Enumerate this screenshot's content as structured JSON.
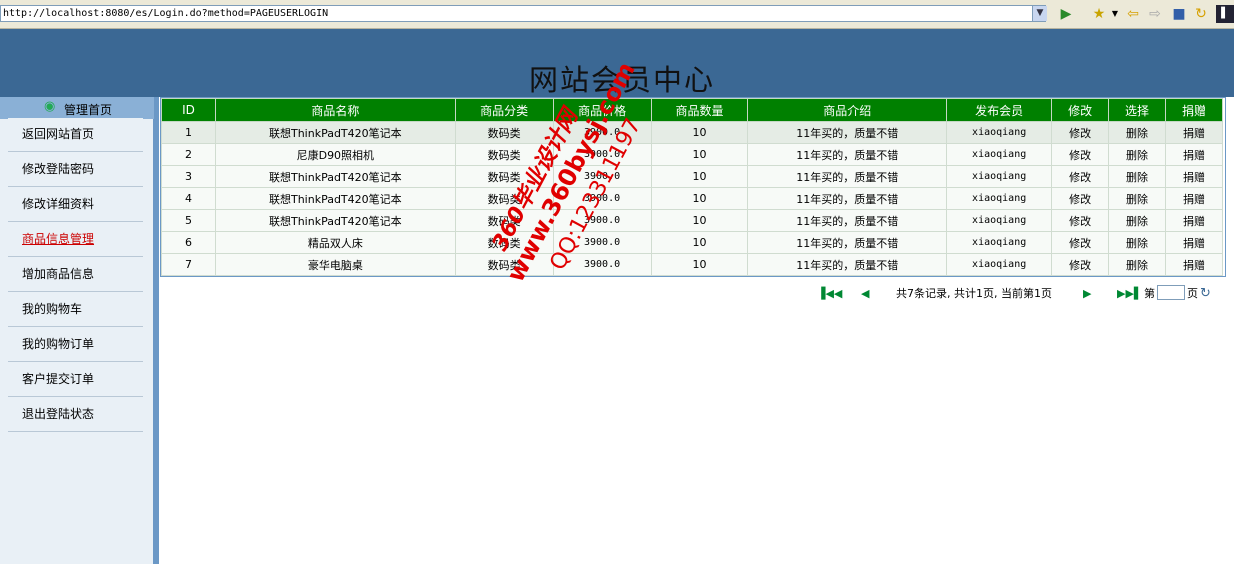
{
  "browser": {
    "url": "http://localhost:8080/es/Login.do?method=PAGEUSERLOGIN"
  },
  "site_title": "网站会员中心",
  "sidebar": {
    "header": "管理首页",
    "items": [
      {
        "label": "返回网站首页"
      },
      {
        "label": "修改登陆密码"
      },
      {
        "label": "修改详细资料"
      },
      {
        "label": "商品信息管理"
      },
      {
        "label": "增加商品信息"
      },
      {
        "label": "我的购物车"
      },
      {
        "label": "我的购物订单"
      },
      {
        "label": "客户提交订单"
      },
      {
        "label": "退出登陆状态"
      }
    ]
  },
  "table": {
    "headers": [
      "ID",
      "商品名称",
      "商品分类",
      "商品价格",
      "商品数量",
      "商品介绍",
      "发布会员",
      "修改",
      "选择",
      "捐赠"
    ],
    "rows": [
      {
        "id": "1",
        "name": "联想ThinkPadT420笔记本",
        "category": "数码类",
        "price": "3900.0",
        "qty": "10",
        "desc": "11年买的，质量不错",
        "member": "xiaoqiang",
        "edit": "修改",
        "del": "删除",
        "donate": "捐赠"
      },
      {
        "id": "2",
        "name": "尼康D90照相机",
        "category": "数码类",
        "price": "3900.0",
        "qty": "10",
        "desc": "11年买的，质量不错",
        "member": "xiaoqiang",
        "edit": "修改",
        "del": "删除",
        "donate": "捐赠"
      },
      {
        "id": "3",
        "name": "联想ThinkPadT420笔记本",
        "category": "数码类",
        "price": "3900.0",
        "qty": "10",
        "desc": "11年买的，质量不错",
        "member": "xiaoqiang",
        "edit": "修改",
        "del": "删除",
        "donate": "捐赠"
      },
      {
        "id": "4",
        "name": "联想ThinkPadT420笔记本",
        "category": "数码类",
        "price": "3900.0",
        "qty": "10",
        "desc": "11年买的，质量不错",
        "member": "xiaoqiang",
        "edit": "修改",
        "del": "删除",
        "donate": "捐赠"
      },
      {
        "id": "5",
        "name": "联想ThinkPadT420笔记本",
        "category": "数码类",
        "price": "3900.0",
        "qty": "10",
        "desc": "11年买的，质量不错",
        "member": "xiaoqiang",
        "edit": "修改",
        "del": "删除",
        "donate": "捐赠"
      },
      {
        "id": "6",
        "name": "精品双人床",
        "category": "数码类",
        "price": "3900.0",
        "qty": "10",
        "desc": "11年买的，质量不错",
        "member": "xiaoqiang",
        "edit": "修改",
        "del": "删除",
        "donate": "捐赠"
      },
      {
        "id": "7",
        "name": "豪华电脑桌",
        "category": "数码类",
        "price": "3900.0",
        "qty": "10",
        "desc": "11年买的，质量不错",
        "member": "xiaoqiang",
        "edit": "修改",
        "del": "删除",
        "donate": "捐赠"
      }
    ]
  },
  "pager": {
    "info": "共7条记录, 共计1页, 当前第1页",
    "page_label": "第",
    "page_unit": "页"
  },
  "watermark": {
    "line1": "360毕业设计网",
    "line2": "www.360bysj.com",
    "line3": "QQ:123311197"
  },
  "colors": {
    "banner": "#3b6894",
    "table_header": "#008000",
    "sidebar_bg": "#e9f0f6",
    "active_menu": "#cc0000",
    "watermark": "#e00000"
  }
}
